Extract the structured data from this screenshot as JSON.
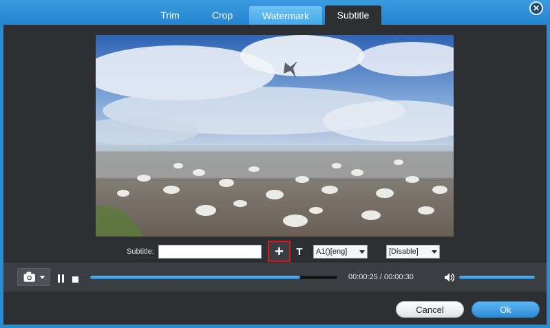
{
  "tabs": [
    {
      "label": "Trim",
      "state": "normal"
    },
    {
      "label": "Crop",
      "state": "normal"
    },
    {
      "label": "Watermark",
      "state": "highlighted"
    },
    {
      "label": "Subtitle",
      "state": "active"
    }
  ],
  "window": {
    "close_icon": "close-icon"
  },
  "subtitle_row": {
    "label": "Subtitle:",
    "input_value": "",
    "add_button_icon": "plus-icon",
    "font_button_label": "T",
    "track_select": "A1()[eng]",
    "mode_select": "[Disable]"
  },
  "player": {
    "snapshot_icon": "camera-icon",
    "current_time": "00:00:25",
    "total_time": "00:00:30",
    "timecode": "00:00:25 / 00:00:30",
    "progress_fraction": 0.85,
    "volume_fraction": 1.0
  },
  "footer": {
    "cancel_label": "Cancel",
    "ok_label": "Ok"
  },
  "colors": {
    "accent": "#2b8cd0",
    "panel": "#2d2f33",
    "highlight_border": "#e0141c"
  }
}
